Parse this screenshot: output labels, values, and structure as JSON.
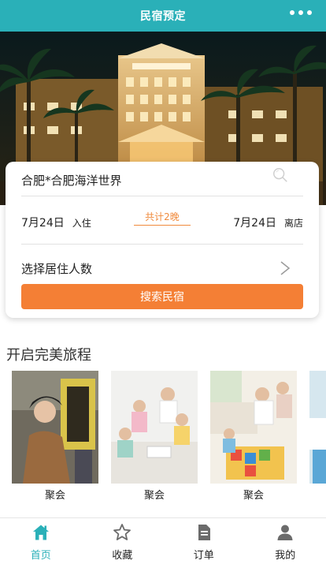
{
  "header": {
    "title": "民宿预定",
    "more_icon": "more-dots-icon"
  },
  "search": {
    "destination": "合肥*合肥海洋世界",
    "checkin_date": "7月24日",
    "checkin_tag": "入住",
    "nights": "共计2晚",
    "checkout_date": "7月24日",
    "checkout_tag": "离店",
    "guests_label": "选择居住人数",
    "button_label": "搜索民宿"
  },
  "section": {
    "title": "开启完美旅程",
    "items": [
      {
        "caption": "聚会"
      },
      {
        "caption": "聚会"
      },
      {
        "caption": "聚会"
      },
      {
        "caption": ""
      }
    ]
  },
  "tabs": [
    {
      "label": "首页",
      "icon": "home-icon",
      "active": true
    },
    {
      "label": "收藏",
      "icon": "star-icon",
      "active": false
    },
    {
      "label": "订单",
      "icon": "order-icon",
      "active": false
    },
    {
      "label": "我的",
      "icon": "user-icon",
      "active": false
    }
  ],
  "colors": {
    "primary": "#2ab0b8",
    "accent": "#f47f35",
    "nights": "#f08a3c"
  }
}
